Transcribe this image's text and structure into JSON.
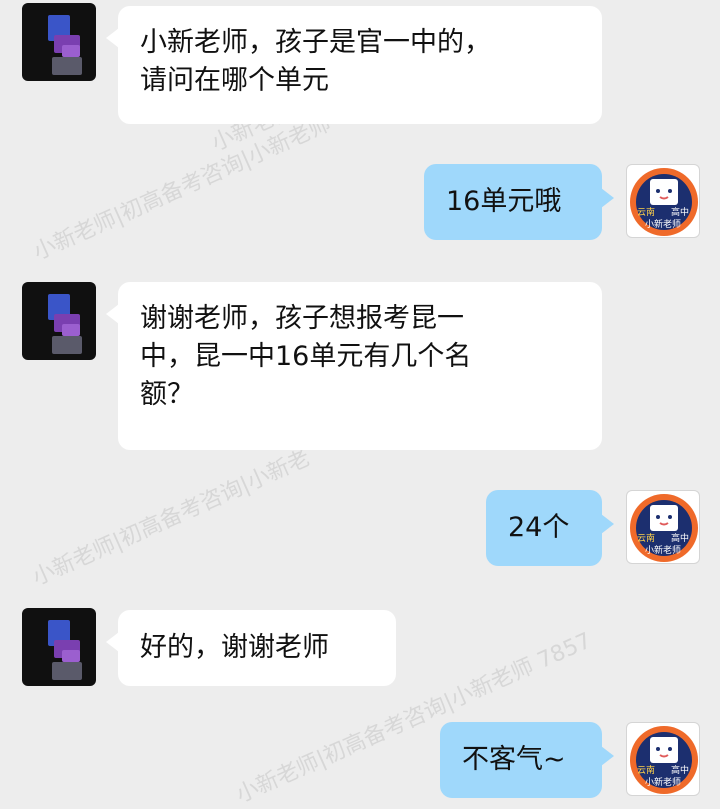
{
  "colors": {
    "background": "#ededed",
    "incoming_bubble": "#ffffff",
    "outgoing_bubble": "#9fd8fb",
    "brand_orange": "#ef6a2a",
    "brand_navy": "#1c2f6f"
  },
  "messages": [
    {
      "side": "incoming",
      "text": "小新老师，孩子是官一中的，\n请问在哪个单元"
    },
    {
      "side": "outgoing",
      "text": "16单元哦"
    },
    {
      "side": "incoming",
      "text": "谢谢老师，孩子想报考昆一\n中，昆一中16单元有几个名\n额？"
    },
    {
      "side": "outgoing",
      "text": "24个"
    },
    {
      "side": "incoming",
      "text": "好的，谢谢老师"
    },
    {
      "side": "outgoing",
      "text": "不客气~"
    }
  ],
  "sender_avatar": {
    "icon": "pixelated-avatar-icon"
  },
  "teacher_avatar": {
    "icon": "school-logo-icon",
    "logo_text_left": "云南",
    "logo_text_right": "高中",
    "logo_text_bottom": "小新老师"
  },
  "watermarks": [
    "小新老师|初高备考咨询|小新老师",
    "小新老师|初高备考咨询|小新",
    "小新老师|初高备考咨询|小新老",
    "小新老师|初高备考咨询|小新老师 7857"
  ]
}
